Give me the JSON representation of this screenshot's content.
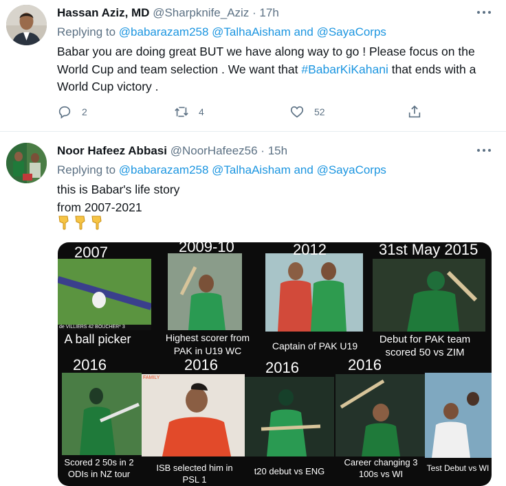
{
  "tweets": [
    {
      "author_name": "Hassan Aziz, MD",
      "handle_time": "@Sharpknife_Aziz · 17h",
      "replying_prefix": "Replying to ",
      "mentions": "@babarazam258 @TalhaAisham and @SayaCorps",
      "text_before": "Babar you are doing great BUT we have along way to go ! Please focus on the World Cup and team selection . We want that ",
      "hashtag": "#BabarKiKahani",
      "text_after": " that ends with a World Cup victory .",
      "reply_count": "2",
      "retweet_count": "4",
      "like_count": "52"
    },
    {
      "author_name": "Noor Hafeez Abbasi",
      "handle_time": "@NoorHafeez56 · 15h",
      "replying_prefix": "Replying to ",
      "mentions": "@babarazam258 @TalhaAisham and @SayaCorps",
      "line1": "this is Babar's life story",
      "line2": "from 2007-2021",
      "emoji": "👇👇👇"
    }
  ],
  "icons": [
    "more-icon",
    "reply-icon",
    "retweet-icon",
    "like-icon",
    "share-icon",
    "pointing-down-emoji"
  ],
  "colors": {
    "link": "#1b95e0",
    "muted": "#5b7083",
    "text": "#0f1419",
    "divider": "#e6ecf0"
  },
  "collage": {
    "row1": [
      {
        "year": "2007",
        "caption": "A ball picker",
        "overlay": "de VILLIERS 42    BOUCHER* 3"
      },
      {
        "year": "2009-10",
        "caption": "Highest scorer from PAK in U19 WC"
      },
      {
        "year": "2012",
        "caption": "Captain of PAK U19"
      },
      {
        "year": "31st May 2015",
        "caption": "Debut for PAK team scored 50 vs ZIM"
      }
    ],
    "row2": [
      {
        "year": "2016",
        "caption": "Scored 2 50s in 2 ODIs in NZ tour"
      },
      {
        "year": "2016",
        "caption": "ISB selected him in PSL 1",
        "overlay": "FAMILY"
      },
      {
        "year": "2016",
        "caption": "t20 debut vs ENG"
      },
      {
        "year": "2016",
        "caption": "Career changing 3 100s vs WI"
      },
      {
        "year": "",
        "caption": "Test Debut vs WI"
      }
    ]
  }
}
